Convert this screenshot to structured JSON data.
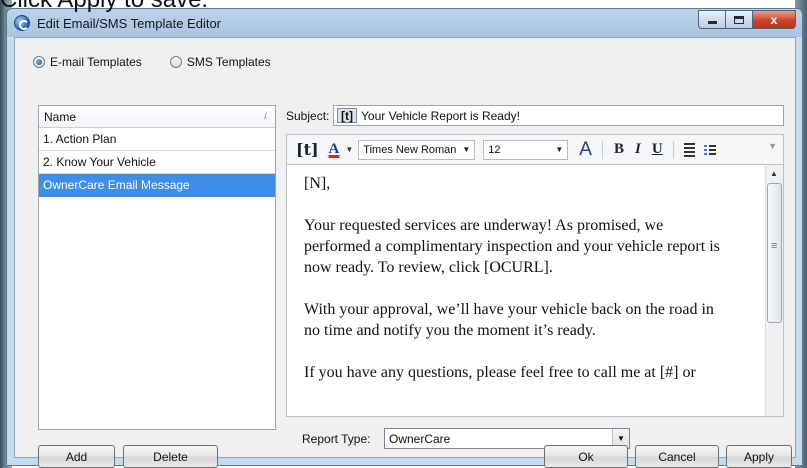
{
  "page_caption": "Click Apply to save.",
  "window": {
    "title": "Edit Email/SMS Template Editor",
    "min_label": "",
    "max_label": "",
    "close_label": "x"
  },
  "template_type": {
    "options": [
      {
        "label": "E-mail Templates",
        "selected": true
      },
      {
        "label": "SMS Templates",
        "selected": false
      }
    ]
  },
  "template_list": {
    "header": "Name",
    "sort_glyph": "/",
    "items": [
      {
        "label": "1. Action Plan",
        "selected": false
      },
      {
        "label": "2. Know Your Vehicle",
        "selected": false
      },
      {
        "label": "OwnerCare Email Message",
        "selected": true
      }
    ]
  },
  "subject": {
    "label": "Subject:",
    "token": "[t]",
    "value": "Your Vehicle Report is Ready!"
  },
  "toolbar": {
    "token_button": "[t]",
    "font_color_button": "A",
    "font_name": "Times New Roman",
    "font_size": "12",
    "grow_font_button": "A",
    "bold": "B",
    "italic": "I",
    "underline": "U"
  },
  "editor": {
    "paragraphs": [
      [
        "[N],"
      ],
      [
        "Your requested services are underway! As promised, we",
        "performed a complimentary inspection and your vehicle report is",
        "now ready.  To review, click [OCURL]."
      ],
      [
        "With your approval, we’ll have your vehicle back on the road in",
        "no time and notify you the moment it’s ready."
      ],
      [
        "If you have any questions, please feel free to call me at [#] or"
      ]
    ]
  },
  "report_type": {
    "label": "Report Type:",
    "value": "OwnerCare"
  },
  "buttons": {
    "add": "Add",
    "delete": "Delete",
    "ok": "Ok",
    "cancel": "Cancel",
    "apply": "Apply"
  },
  "colors": {
    "selection": "#3d8ee8",
    "title_bar": "#bcd3ea",
    "close_button": "#c8462a"
  }
}
